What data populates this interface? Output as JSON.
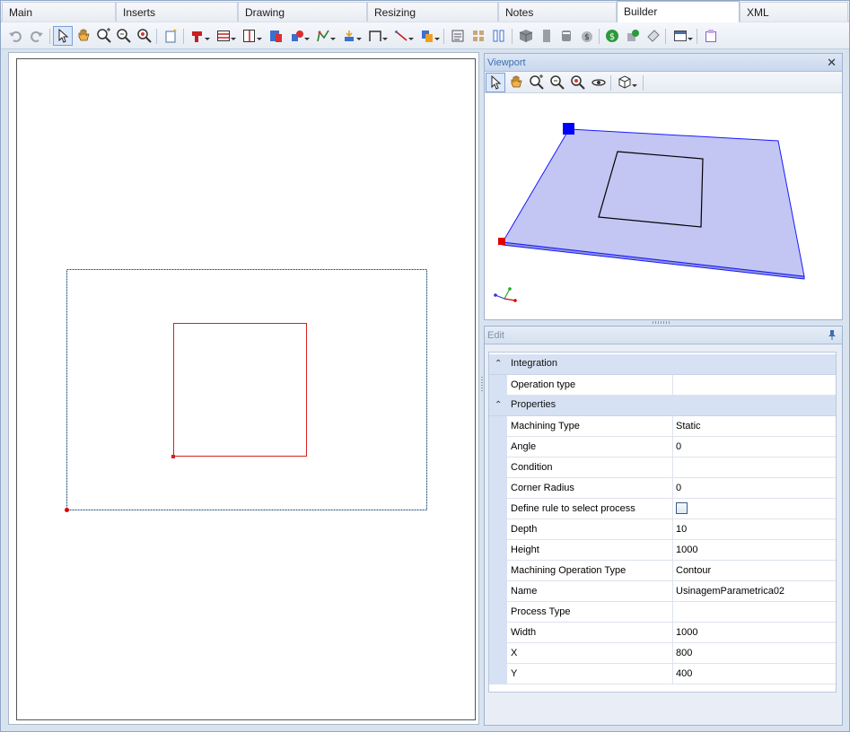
{
  "tabs": [
    {
      "label": "Main"
    },
    {
      "label": "Inserts"
    },
    {
      "label": "Drawing"
    },
    {
      "label": "Resizing"
    },
    {
      "label": "Notes"
    },
    {
      "label": "Builder"
    },
    {
      "label": "XML"
    }
  ],
  "active_tab": "Builder",
  "viewport": {
    "title": "Viewport",
    "close_glyph": "✕"
  },
  "edit": {
    "title": "Edit",
    "categories": [
      {
        "label": "Integration",
        "toggle": "⌃"
      },
      {
        "label": "Properties",
        "toggle": "⌃"
      }
    ],
    "integration_rows": [
      {
        "name": "Operation type",
        "value": ""
      }
    ],
    "property_rows": [
      {
        "name": "Machining Type",
        "value": "Static"
      },
      {
        "name": "Angle",
        "value": "0"
      },
      {
        "name": "Condition",
        "value": ""
      },
      {
        "name": "Corner Radius",
        "value": "0"
      },
      {
        "name": "Define rule to select process",
        "value": ""
      },
      {
        "name": "Depth",
        "value": "10"
      },
      {
        "name": "Height",
        "value": "1000"
      },
      {
        "name": "Machining Operation Type",
        "value": "Contour"
      },
      {
        "name": "Name",
        "value": "UsinagemParametrica02"
      },
      {
        "name": "Process Type",
        "value": ""
      },
      {
        "name": "Width",
        "value": "1000"
      },
      {
        "name": "X",
        "value": "800"
      },
      {
        "name": "Y",
        "value": "400"
      }
    ],
    "define_rule_checked": false
  },
  "colors": {
    "outer_rect": "#1f4f7a",
    "inner_rect": "#d62020",
    "plate_fill": "#c3c6f3",
    "plate_edge": "#1a1aff",
    "marker_blue": "#0000ff",
    "marker_red": "#e00000"
  },
  "icons": {
    "toolbar": [
      "undo-icon",
      "redo-icon",
      "select-arrow-icon",
      "pan-hand-icon",
      "zoom-extents-icon",
      "zoom-in-icon",
      "zoom-out-icon",
      "new-note-icon",
      "drill-icon",
      "horizontal-division-icon",
      "vertical-division-icon",
      "insert-component-icon",
      "shapes-icon",
      "path-icon",
      "align-icon",
      "dimension-icon",
      "line-icon",
      "copy-icon",
      "report-icon",
      "cutlist-icon",
      "panels-icon",
      "box-icon",
      "material-icon",
      "edgeband-icon",
      "cost-icon",
      "dollar-icon",
      "assembly-icon",
      "label-icon",
      "window-icon",
      "clipboard-icon"
    ],
    "viewport_toolbar": [
      "select-arrow-icon",
      "pan-hand-icon",
      "zoom-extents-icon",
      "zoom-in-icon",
      "zoom-out-icon",
      "orbit-icon",
      "view-cube-icon"
    ]
  }
}
